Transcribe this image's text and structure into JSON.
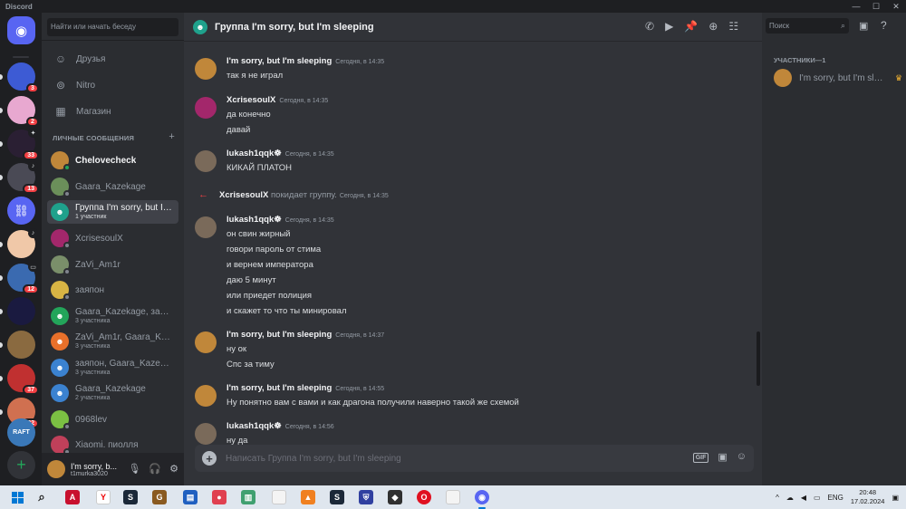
{
  "window": {
    "app": "Discord",
    "minimize": "—",
    "maximize": "☐",
    "close": "✕"
  },
  "colors": {
    "blurple": "#5865f2",
    "bg_chat": "#313338",
    "bg_sidebar": "#2b2d31",
    "bg_rail": "#1e1f22",
    "online": "#23a55a",
    "red": "#f23f43",
    "group_teal": "#1fa18c"
  },
  "servers": [
    {
      "name": "home",
      "badge": ""
    },
    {
      "name": "server-1",
      "badge": "3"
    },
    {
      "name": "server-nitro",
      "badge": "2"
    },
    {
      "name": "server-3",
      "badge": "33"
    },
    {
      "name": "server-4",
      "badge": "13"
    },
    {
      "name": "server-link",
      "badge": ""
    },
    {
      "name": "server-6",
      "badge": ""
    },
    {
      "name": "server-7",
      "badge": "12"
    },
    {
      "name": "server-8",
      "badge": ""
    },
    {
      "name": "server-9",
      "badge": ""
    },
    {
      "name": "server-10",
      "badge": "37"
    },
    {
      "name": "server-11",
      "badge": "22"
    },
    {
      "name": "server-raft",
      "badge": ""
    }
  ],
  "sidebar": {
    "search_placeholder": "Найти или начать беседу",
    "nav": [
      {
        "label": "Друзья",
        "icon": "friends-icon"
      },
      {
        "label": "Nitro",
        "icon": "nitro-icon"
      },
      {
        "label": "Магазин",
        "icon": "shop-icon"
      }
    ],
    "dm_header": "ЛИЧНЫЕ СООБЩЕНИЯ",
    "dm_add": "+",
    "dms": [
      {
        "name": "Chelovecheck",
        "sub": "",
        "color": "#c0873a",
        "bold": true
      },
      {
        "name": "Gaara_Kazekage",
        "sub": "",
        "color": "#6b8f5a"
      },
      {
        "name": "Группа I'm sorry, but I'm sleeping",
        "sub": "1 участник",
        "color": "#1fa18c",
        "active": true
      },
      {
        "name": "XcrisesoulX",
        "sub": "",
        "color": "#a3276b"
      },
      {
        "name": "ZaVi_Am1r",
        "sub": "",
        "color": "#7a8f6a"
      },
      {
        "name": "заяпон",
        "sub": "",
        "color": "#d8b444"
      },
      {
        "name": "Gaara_Kazekage, заяпон",
        "sub": "3 участника",
        "color": "#23a55a"
      },
      {
        "name": "ZaVi_Am1r, Gaara_Kazekage",
        "sub": "3 участника",
        "color": "#e8702a"
      },
      {
        "name": "заяпон, Gaara_Kazekage",
        "sub": "3 участника",
        "color": "#3b82d0"
      },
      {
        "name": "Gaara_Kazekage",
        "sub": "2 участника",
        "color": "#3b82d0"
      },
      {
        "name": "0968lev",
        "sub": "",
        "color": "#7bc043"
      },
      {
        "name": "Xiaomi. пиолля",
        "sub": "",
        "color": "#c0405a"
      }
    ]
  },
  "user": {
    "name": "I'm sorry, b...",
    "tag": "t1murka3020"
  },
  "chat": {
    "title": "Группа I'm sorry, but I'm sleeping",
    "header_icons": [
      "call-icon",
      "video-icon",
      "pin-icon",
      "add-friend-icon",
      "members-icon",
      "inbox-icon",
      "help-icon"
    ],
    "search_placeholder": "Поиск",
    "composer_placeholder": "Написать Группа I'm sorry, but I'm sleeping",
    "gif": "GIF",
    "messages": [
      {
        "author": "I'm sorry, but I'm sleeping",
        "time": "Сегодня, в 14:35",
        "lines": [
          "так я не играл"
        ],
        "color": "#c0873a"
      },
      {
        "author": "XcrisesoulX",
        "time": "Сегодня, в 14:35",
        "lines": [
          "да конечно",
          "давай"
        ],
        "color": "#a3276b"
      },
      {
        "author": "lukash1qqk☸",
        "time": "Сегодня, в 14:35",
        "lines": [
          "КИКАЙ ПЛАТОН"
        ],
        "color": "#7a6a5a"
      },
      {
        "author": "lukash1qqk☸",
        "time": "Сегодня, в 14:35",
        "lines": [
          "он свин жирный",
          "говори пароль от стима",
          "и вернем императора",
          "даю 5 минут",
          "или приедет полиция",
          "и скажет то что ты минировал"
        ],
        "color": "#7a6a5a"
      },
      {
        "author": "I'm sorry, but I'm sleeping",
        "time": "Сегодня, в 14:37",
        "lines": [
          "ну ок",
          "Спс за тиму"
        ],
        "color": "#c0873a"
      },
      {
        "author": "I'm sorry, but I'm sleeping",
        "time": "Сегодня, в 14:55",
        "lines": [
          "Ну понятно вам с вами и как драгона получили наверно такой же схемой"
        ],
        "color": "#c0873a"
      },
      {
        "author": "lukash1qqk☸",
        "time": "Сегодня, в 14:56",
        "lines": [
          "ну да"
        ],
        "color": "#7a6a5a"
      }
    ],
    "system": {
      "arrow": "←",
      "author": "XcrisesoulX",
      "text": "покидает группу.",
      "time": "Сегодня, в 14:35"
    }
  },
  "members": {
    "label": "УЧАСТНИКИ—1",
    "list": [
      {
        "name": "I'm sorry, but I'm sleeping",
        "crown": "♛"
      }
    ]
  },
  "taskbar": {
    "lang": "ENG",
    "time": "20:48",
    "date": "17.02.2024",
    "chevron": "^"
  }
}
